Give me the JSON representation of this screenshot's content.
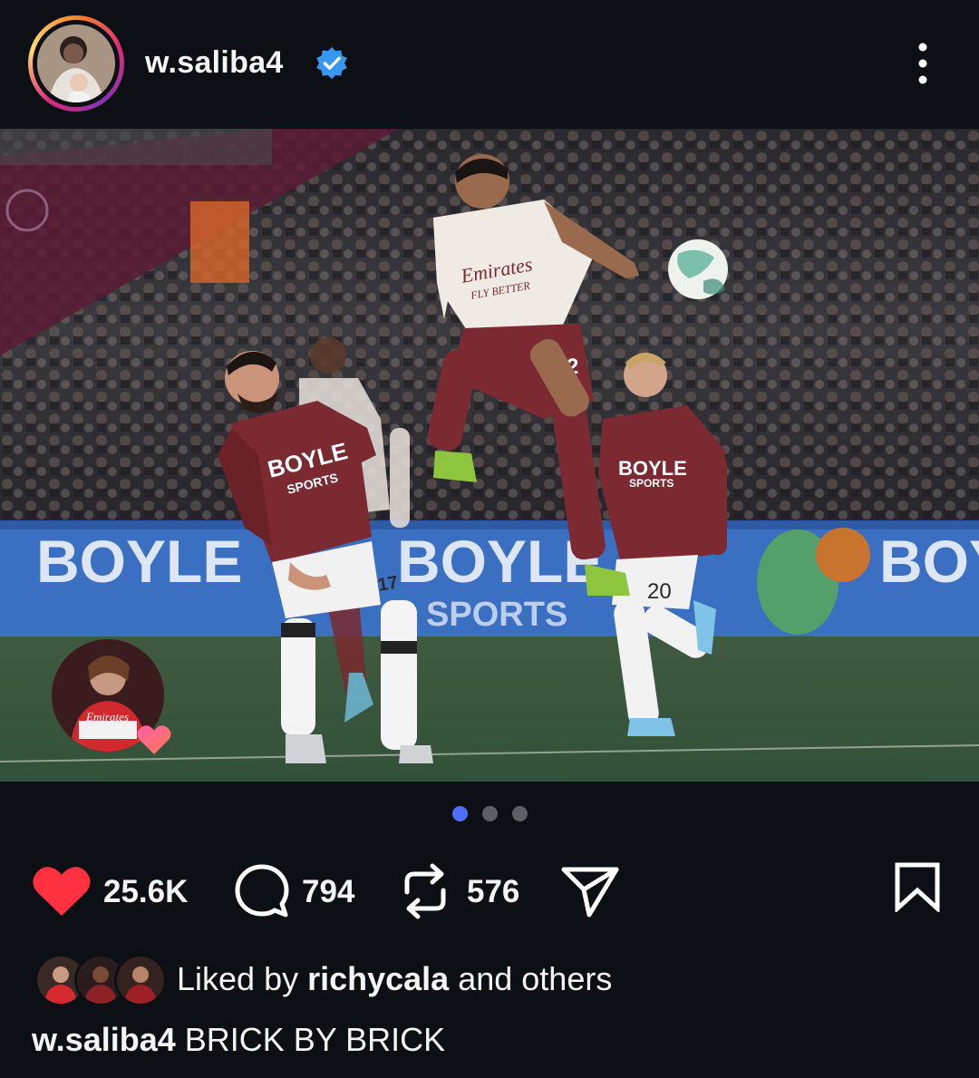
{
  "post": {
    "username": "w.saliba4",
    "verified": true,
    "more_icon": "more-vertical-icon"
  },
  "media": {
    "shirt_sponsor": "Emirates",
    "shirt_slogan": "FLY BETTER",
    "home_sponsor": "BOYLE",
    "home_sponsor_line2": "SPORTS",
    "player_number_1": "17",
    "player_number_2": "20",
    "player_number_3": "2",
    "board_text": "BOYLE",
    "board_text_2": "SPORTS",
    "story_shirt_text": "Emirates",
    "page_count": 3,
    "active_page": 1
  },
  "actions": {
    "likes": "25.6K",
    "comments": "794",
    "reposts": "576"
  },
  "liked_by": {
    "prefix": "Liked by ",
    "user": "richycala",
    "suffix": " and others"
  },
  "caption": {
    "username": "w.saliba4",
    "text": " BRICK BY BRICK"
  },
  "colors": {
    "background": "#0c1014",
    "like": "#ff3040",
    "verified": "#3897f0",
    "active_dot": "#4f6df5"
  }
}
